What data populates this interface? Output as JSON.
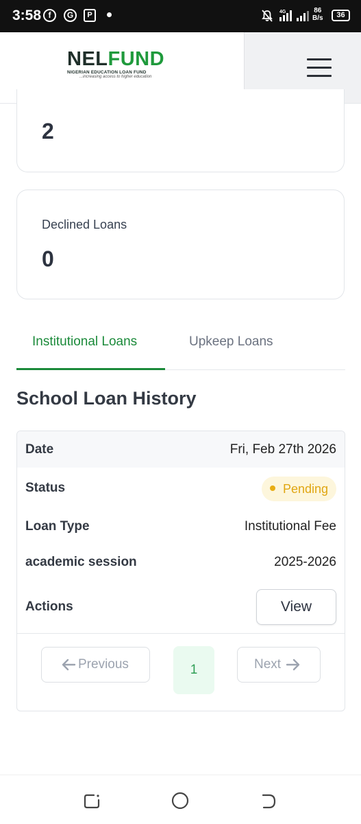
{
  "status_bar": {
    "time": "3:58",
    "network_speed_value": "86",
    "network_speed_unit": "B/s",
    "network_type": "4G",
    "battery_level": "36"
  },
  "header": {
    "logo": {
      "brand_part1": "NEL",
      "brand_part2": "FUND",
      "full_name": "NIGERIAN EDUCATION LOAN FUND",
      "tagline": "...increasing access to higher education"
    },
    "menu_icon": "hamburger-menu-icon"
  },
  "cards": {
    "partial_card_value": "2",
    "declined": {
      "label": "Declined Loans",
      "value": "0"
    }
  },
  "tabs": [
    {
      "label": "Institutional Loans",
      "active": true
    },
    {
      "label": "Upkeep Loans",
      "active": false
    }
  ],
  "section_title": "School Loan History",
  "loan_history": {
    "rows": {
      "date": {
        "label": "Date",
        "value": "Fri, Feb 27th 2026"
      },
      "status": {
        "label": "Status",
        "value": "Pending"
      },
      "loan_type": {
        "label": "Loan Type",
        "value": "Institutional Fee"
      },
      "session": {
        "label": "academic session",
        "value": "2025-2026"
      },
      "actions": {
        "label": "Actions",
        "button": "View"
      }
    },
    "pagination": {
      "previous": "Previous",
      "current_page": "1",
      "next": "Next"
    }
  },
  "colors": {
    "brand_green": "#1b8a3a",
    "pending_text": "#e0a612",
    "pending_bg": "#fdf6dc",
    "page_active_bg": "#eafaf0"
  }
}
